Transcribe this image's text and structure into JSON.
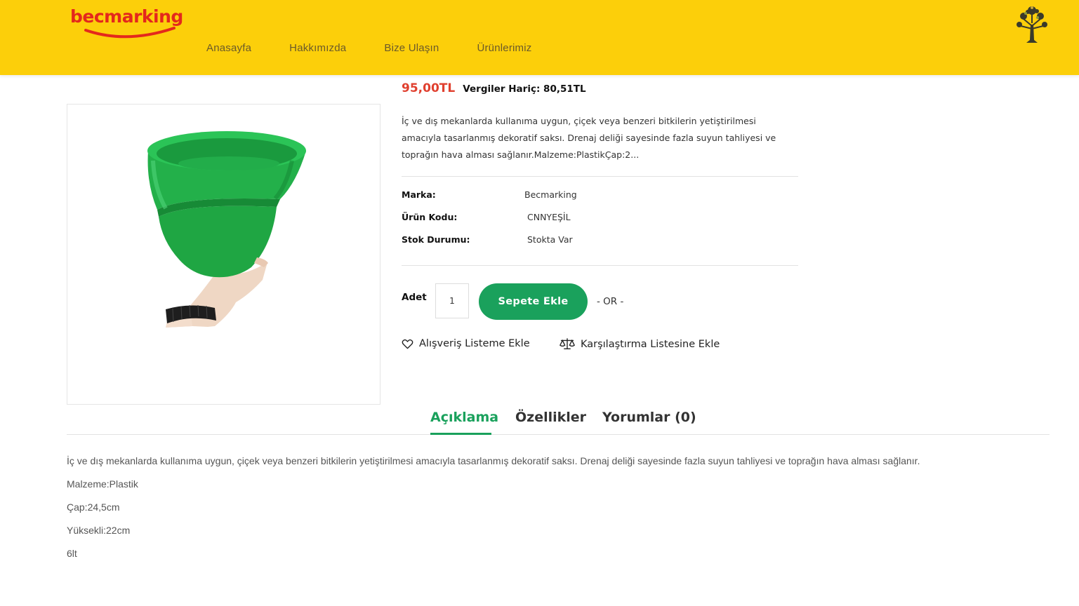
{
  "header": {
    "logo_text": "becmarking",
    "nav": [
      "Anasayfa",
      "Hakkımızda",
      "Bize Ulaşın",
      "Ürünlerimiz"
    ],
    "right_icon": "tree-icon",
    "background_color": "#fccf0a"
  },
  "product": {
    "image_icon": "green-flower-pot-image",
    "price": "95,00TL",
    "price_ex_tax": "Vergiler Hariç: 80,51TL",
    "short_description": "İç ve dış mekanlarda kullanıma uygun, çiçek veya benzeri bitkilerin yetiştirilmesi amacıyla tasarlanmış dekoratif saksı. Drenaj deliği sayesinde fazla suyun tahliyesi ve toprağın hava alması sağlanır.Malzeme:PlastikÇap:2...",
    "specs": [
      {
        "label": "Marka:",
        "value": "Becmarking"
      },
      {
        "label": "Ürün Kodu:",
        "value": "CNNYEŞİL"
      },
      {
        "label": "Stok Durumu:",
        "value": "Stokta Var"
      }
    ],
    "quantity_label": "Adet",
    "quantity_value": "1",
    "add_to_cart": "Sepete Ekle",
    "or_text": "- OR -",
    "wishlist": "Alışveriş Listeme Ekle",
    "compare": "Karşılaştırma Listesine Ekle",
    "accent_color": "#1aa15c",
    "price_color": "#e0402f"
  },
  "tabs": [
    {
      "label": "Açıklama",
      "active": true
    },
    {
      "label": "Özellikler",
      "active": false
    },
    {
      "label": "Yorumlar (0)",
      "active": false
    }
  ],
  "description": [
    "İç ve dış mekanlarda kullanıma uygun, çiçek veya benzeri bitkilerin yetiştirilmesi amacıyla tasarlanmış dekoratif saksı. Drenaj deliği sayesinde fazla suyun tahliyesi ve toprağın hava alması sağlanır.",
    "Malzeme:Plastik",
    "Çap:24,5cm",
    "Yüksekli:22cm",
    "6lt"
  ]
}
